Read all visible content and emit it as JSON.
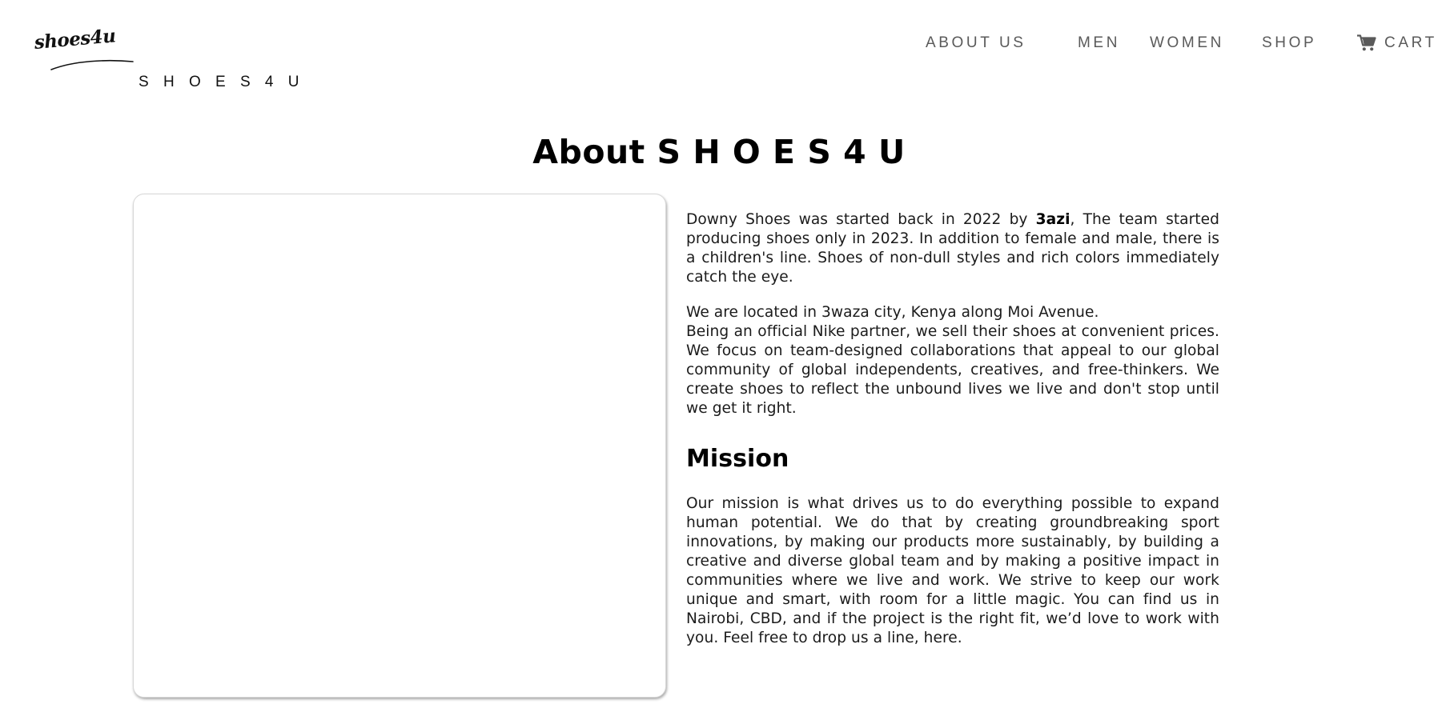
{
  "header": {
    "logo_script": "shoes4u",
    "brand_text": "S H O E S 4 U",
    "nav": [
      {
        "label": "ABOUT US"
      },
      {
        "label": "MEN"
      },
      {
        "label": "WOMEN"
      },
      {
        "label": "SHOP"
      }
    ],
    "cart_label": "CART",
    "cart_icon": "shopping-cart-icon"
  },
  "main": {
    "title": "About S H O E S 4 U",
    "intro": {
      "part1": "Downy Shoes was started back in 2022 by ",
      "founder": "3azi",
      "part2": ", The team started producing shoes only in 2023. In addition to female and male, there is a children's line. Shoes of non-dull styles and rich colors immediately catch the eye."
    },
    "location": "We are located in 3waza city, Kenya along Moi Avenue.",
    "partner": "Being an official Nike partner, we sell their shoes at convenient prices. We focus on team-designed collaborations that appeal to our global community of global independents, creatives, and free-thinkers. We create shoes to reflect the unbound lives we live and don't stop until we get it right.",
    "mission_heading": "Mission",
    "mission_text": "Our mission is what drives us to do everything possible to expand human potential. We do that by creating groundbreaking sport innovations, by making our products more sustainably, by building a creative and diverse global team and by making a positive impact in communities where we live and work. We strive to keep our work unique and smart, with room for a little magic. You can find us in Nairobi, CBD, and if the project is the right fit, we’d love to work with you. Feel free to drop us a line, here."
  },
  "colors": {
    "nav_text": "#5a5a5a",
    "body_text": "#1b1b1b",
    "heading": "#000000",
    "card_border": "#d8d8d8"
  }
}
